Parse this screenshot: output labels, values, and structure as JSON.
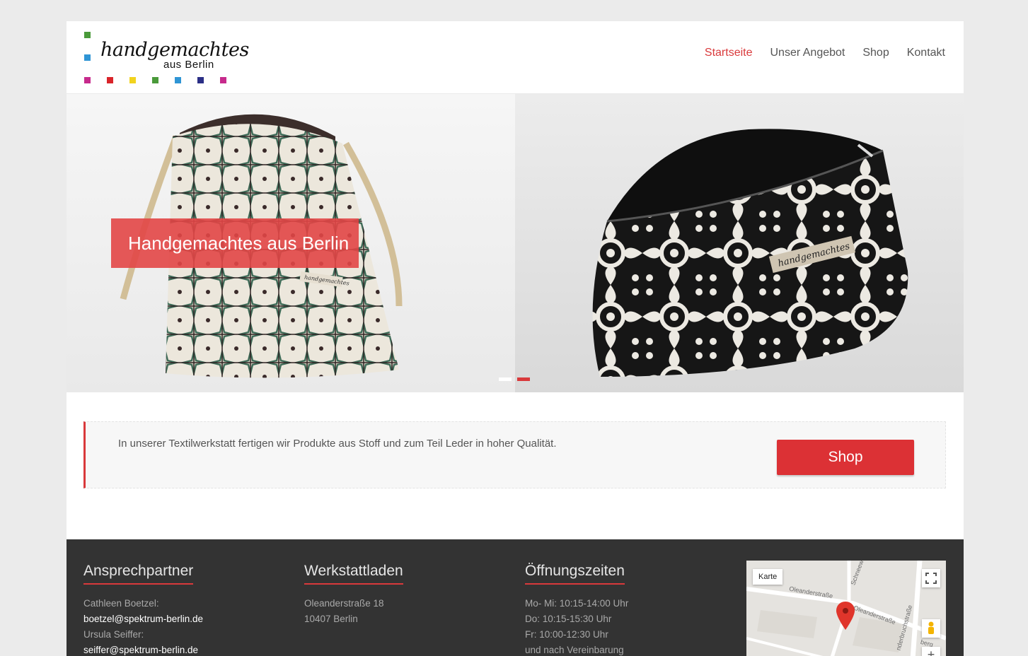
{
  "logo": {
    "script": "handgemachtes",
    "sub": "aus Berlin",
    "squares": [
      "#4a9a3a",
      "#2f95d5",
      "#c72a8c",
      "#d9242a",
      "#f2d31e",
      "#4a9a3a",
      "#2f95d5",
      "#2b2f86",
      "#c72a8c"
    ]
  },
  "nav": {
    "items": [
      {
        "label": "Startseite",
        "active": true
      },
      {
        "label": "Unser Angebot",
        "active": false
      },
      {
        "label": "Shop",
        "active": false
      },
      {
        "label": "Kontakt",
        "active": false
      }
    ]
  },
  "slider": {
    "caption": "Handgemachtes aus Berlin",
    "label_left": "handgemachtes",
    "label_right": "handgemachtes",
    "dots": 2,
    "active_dot": 2
  },
  "callout": {
    "text": "In unserer Textilwerkstatt fertigen wir Produkte aus Stoff und zum Teil Leder in hoher Qualität.",
    "button": "Shop"
  },
  "footer": {
    "contact": {
      "title": "Ansprechpartner",
      "name1": "Cathleen Boetzel:",
      "email1": "boetzel@spektrum-berlin.de",
      "name2": "Ursula Seiffer:",
      "email2": "seiffer@spektrum-berlin.de"
    },
    "shop": {
      "title": "Werkstattladen",
      "street": "Oleanderstraße 18",
      "city": "10407 Berlin"
    },
    "hours": {
      "title": "Öffnungszeiten",
      "line1": "Mo- Mi: 10:15-14:00 Uhr",
      "line2": "Do: 10:15-15:30 Uhr",
      "line3": "Fr: 10:00-12:30 Uhr",
      "line4": "und nach Vereinbarung"
    },
    "map": {
      "karte": "Karte",
      "street1": "Oleanderstraße",
      "street2": "Oleanderstraße",
      "street3": "Schneew",
      "street4": "nderbruchstraße",
      "street5": "berg"
    }
  },
  "colors": {
    "accent": "#d9393b",
    "footer_bg": "#333333"
  }
}
